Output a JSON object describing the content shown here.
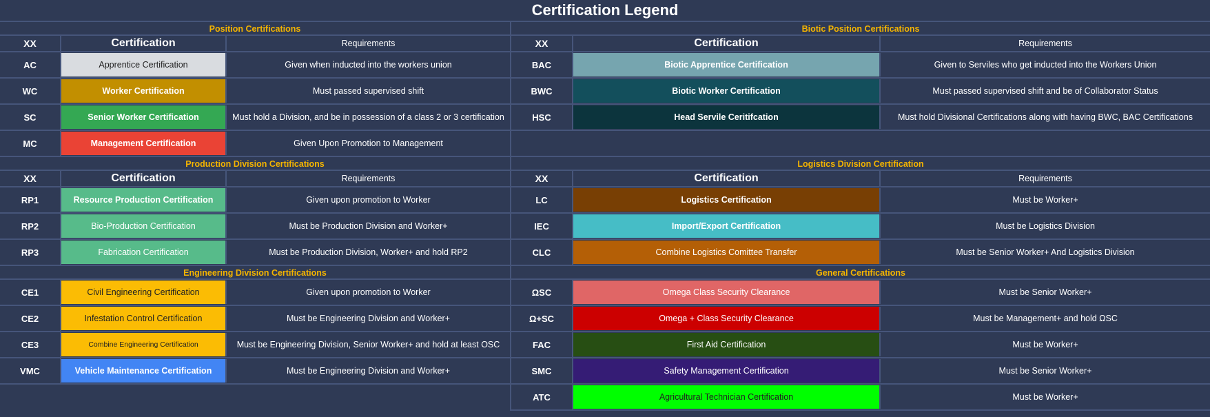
{
  "title": "Certification Legend",
  "headers": {
    "code": "XX",
    "certification": "Certification",
    "requirements": "Requirements"
  },
  "position": {
    "title": "Position Certifications",
    "rows": [
      {
        "code": "AC",
        "name": "Apprentice Certification",
        "req": "Given when inducted into the workers union",
        "bg": "#d9dce0",
        "fg": "#222222",
        "bold": false
      },
      {
        "code": "WC",
        "name": "Worker Certification",
        "req": "Must passed supervised shift",
        "bg": "#c28f00",
        "fg": "#ffffff",
        "bold": true
      },
      {
        "code": "SC",
        "name": "Senior Worker Certification",
        "req": "Must hold a Division, and be in possession of a class 2 or 3 certification",
        "bg": "#34a853",
        "fg": "#ffffff",
        "bold": true
      },
      {
        "code": "MC",
        "name": "Management Certification",
        "req": "Given Upon Promotion to Management",
        "bg": "#ea4335",
        "fg": "#ffffff",
        "bold": true
      }
    ]
  },
  "biotic": {
    "title": "Biotic Position Certifications",
    "rows": [
      {
        "code": "BAC",
        "name": "Biotic Apprentice Certification",
        "req": "Given to Serviles who get inducted into the Workers Union",
        "bg": "#76a5af",
        "fg": "#ffffff",
        "bold": true
      },
      {
        "code": "BWC",
        "name": "Biotic Worker Certification",
        "req": "Must passed supervised shift and be of Collaborator Status",
        "bg": "#134f5c",
        "fg": "#ffffff",
        "bold": true
      },
      {
        "code": "HSC",
        "name": "Head Servile Ceritifcation",
        "req": "Must hold Divisional Certifications along with having BWC, BAC Certifications",
        "bg": "#0c343d",
        "fg": "#ffffff",
        "bold": true
      }
    ]
  },
  "production": {
    "title": "Production Division Certifications",
    "rows": [
      {
        "code": "RP1",
        "name": "Resource Production Certification",
        "req": "Given upon promotion to Worker",
        "bg": "#57bb8a",
        "fg": "#ffffff",
        "bold": true
      },
      {
        "code": "RP2",
        "name": "Bio-Production Certification",
        "req": "Must be Production Division and Worker+",
        "bg": "#57bb8a",
        "fg": "#ffffff",
        "bold": false
      },
      {
        "code": "RP3",
        "name": "Fabrication Certification",
        "req": "Must be Production Division, Worker+ and hold RP2",
        "bg": "#57bb8a",
        "fg": "#ffffff",
        "bold": false
      }
    ]
  },
  "logistics": {
    "title": "Logistics Division Certification",
    "rows": [
      {
        "code": "LC",
        "name": "Logistics Certification",
        "req": "Must be Worker+",
        "bg": "#783f04",
        "fg": "#ffffff",
        "bold": true
      },
      {
        "code": "IEC",
        "name": "Import/Export Certification",
        "req": "Must be Logistics Division",
        "bg": "#46bdc6",
        "fg": "#ffffff",
        "bold": true
      },
      {
        "code": "CLC",
        "name": "Combine Logistics Comittee Transfer",
        "req": "Must be Senior Worker+ And Logistics Division",
        "bg": "#b45f06",
        "fg": "#ffffff",
        "bold": false
      }
    ]
  },
  "engineering": {
    "title": "Engineering Division Certifications",
    "rows": [
      {
        "code": "CE1",
        "name": "Civil Engineering Certification",
        "req": "Given upon promotion to Worker",
        "bg": "#fbbc04",
        "fg": "#222222",
        "bold": false
      },
      {
        "code": "CE2",
        "name": "Infestation Control Certification",
        "req": "Must be Engineering Division and Worker+",
        "bg": "#fbbc04",
        "fg": "#222222",
        "bold": false
      },
      {
        "code": "CE3",
        "name": "Combine Engineering Certification",
        "req": "Must be Engineering Division, Senior Worker+ and hold at least OSC",
        "bg": "#fbbc04",
        "fg": "#222222",
        "bold": false,
        "small": true
      },
      {
        "code": "VMC",
        "name": "Vehicle Maintenance Certification",
        "req": "Must be Engineering Division and Worker+",
        "bg": "#4285f4",
        "fg": "#ffffff",
        "bold": true
      }
    ]
  },
  "general": {
    "title": "General Certifications",
    "rows": [
      {
        "code": "ΩSC",
        "name": "Omega Class Security Clearance",
        "req": "Must be Senior Worker+",
        "bg": "#e06666",
        "fg": "#ffffff",
        "bold": false
      },
      {
        "code": "Ω+SC",
        "name": "Omega + Class Security Clearance",
        "req": "Must be Management+ and hold ΩSC",
        "bg": "#cc0000",
        "fg": "#ffffff",
        "bold": false
      },
      {
        "code": "FAC",
        "name": "First Aid Certification",
        "req": "Must be Worker+",
        "bg": "#274e13",
        "fg": "#ffffff",
        "bold": false
      },
      {
        "code": "SMC",
        "name": "Safety Management Certification",
        "req": "Must be Senior Worker+",
        "bg": "#351c75",
        "fg": "#ffffff",
        "bold": false
      },
      {
        "code": "ATC",
        "name": "Agricultural Technician Certification",
        "req": "Must be Worker+",
        "bg": "#00ff00",
        "fg": "#222222",
        "bold": false
      }
    ]
  }
}
